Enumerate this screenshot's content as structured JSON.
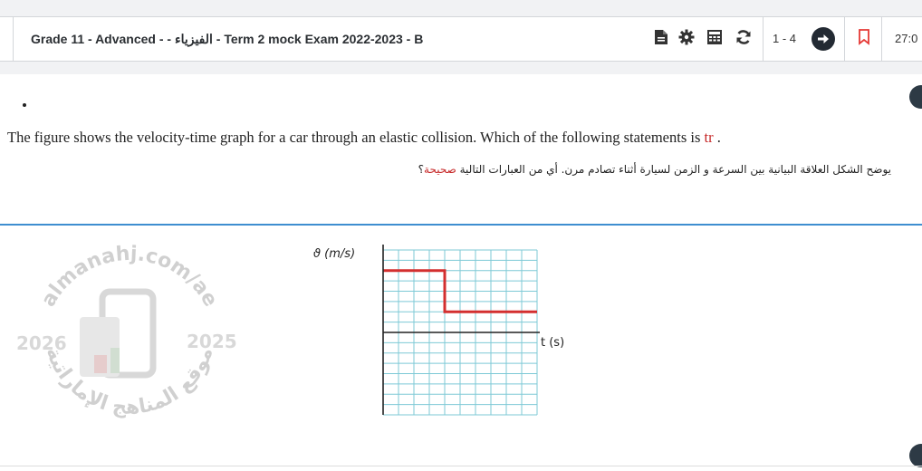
{
  "header": {
    "exam_title": "Grade 11 - Advanced - - الفيزياء - Term 2 mock Exam 2022-2023 - B",
    "question_range": "1 - 4",
    "timer": "27:0"
  },
  "toolbar": {
    "icons": [
      "document-icon",
      "gear-icon",
      "calculator-icon",
      "refresh-icon",
      "arrow-right-icon",
      "bookmark-icon"
    ]
  },
  "question": {
    "marker": "•",
    "english_main": "The figure shows the velocity-time graph for a car through an elastic collision. Which of the following statements is ",
    "english_highlight": "tr",
    "english_end": " .",
    "arabic_main": "يوضح الشكل العلاقة البيانية بين السرعة و الزمن  لسيارة أثناء تصادم مرن. أي من العبارات التالية ",
    "arabic_highlight": "صحيحة",
    "arabic_end": "؟"
  },
  "graph": {
    "y_axis_label": "ϑ (m/s)",
    "x_axis_label": "t (s)"
  },
  "chart_data": {
    "type": "line",
    "title": "",
    "xlabel": "t (s)",
    "ylabel": "ϑ (m/s)",
    "grid": true,
    "series": [
      {
        "x": [
          0,
          4,
          4,
          10
        ],
        "values": [
          6,
          6,
          2,
          2
        ]
      }
    ],
    "xlim": [
      0,
      10
    ],
    "ylim": [
      -8,
      8
    ]
  },
  "watermark": {
    "site_text": "almanahj.com/ae",
    "arabic_text": "موقع المناهج الإماراتية",
    "year_left": "2026",
    "year_right": "2025"
  },
  "colors": {
    "accent_blue": "#3e8ed0",
    "highlight_red": "#c62828",
    "graph_line": "#d32f2f",
    "grid": "#7ec9d6",
    "bookmark": "#e53935"
  }
}
